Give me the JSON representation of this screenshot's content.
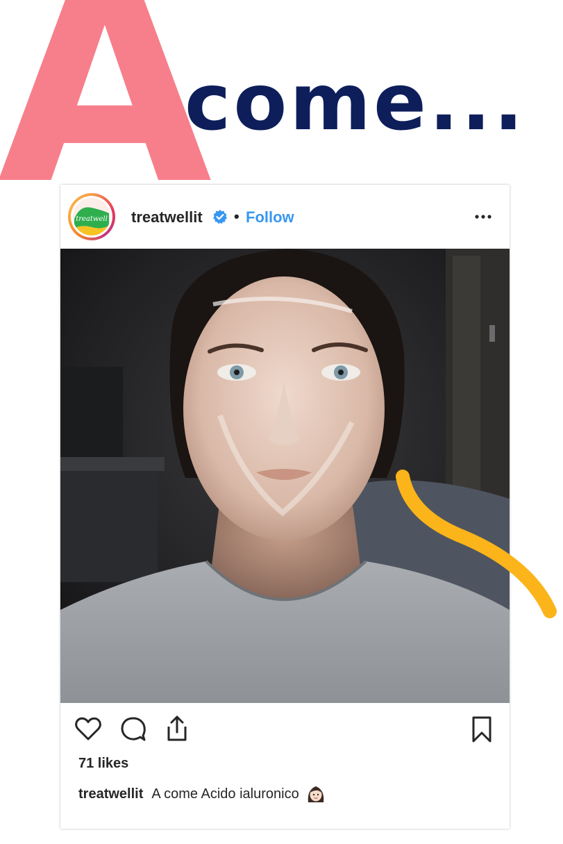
{
  "headline": {
    "letter": "A",
    "word": "come..."
  },
  "post": {
    "username": "treatwellit",
    "follow_label": "Follow",
    "separator": "•",
    "avatar_logo_text": "treatwell",
    "likes": "71 likes",
    "caption_user": "treatwellit",
    "caption_text": "A come Acido ialuronico"
  },
  "icons": {
    "verified": "verified-badge-icon",
    "more": "more-options-icon",
    "like": "heart-icon",
    "comment": "comment-icon",
    "share": "share-icon",
    "save": "bookmark-icon",
    "emoji": "woman-face-emoji"
  },
  "colors": {
    "letter_pink": "#f67f8b",
    "headline_navy": "#0d1e5a",
    "follow_blue": "#3897f0",
    "swoosh_yellow": "#fbb41a",
    "text_dark": "#262626"
  }
}
